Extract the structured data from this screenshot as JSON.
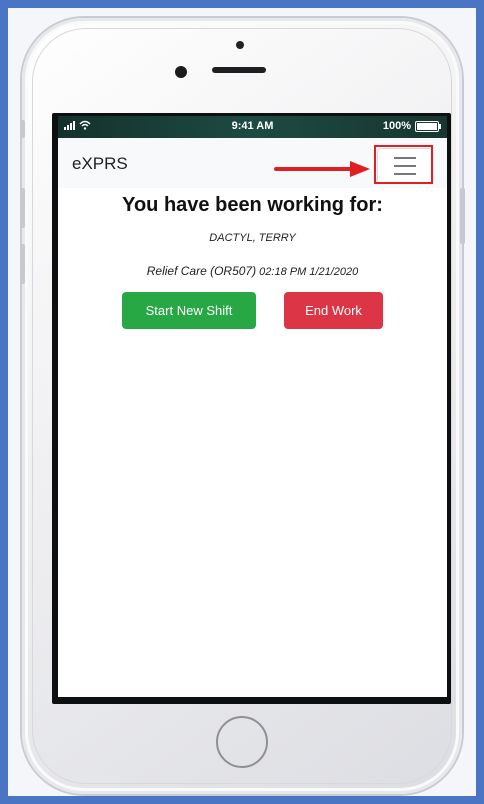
{
  "status_bar": {
    "time": "9:41 AM",
    "battery": "100%"
  },
  "app": {
    "brand": "eXPRS"
  },
  "main": {
    "heading": "You have been working for:",
    "client_name": "DACTYL, TERRY",
    "service": "Relief Care (OR507)",
    "start_time": "02:18 PM",
    "start_date": "1/21/2020",
    "start_button_label": "Start New Shift",
    "end_button_label": "End Work"
  },
  "colors": {
    "start_button": "#28a745",
    "end_button": "#dc3545",
    "annotation": "#e02020",
    "background": "#4a74c4"
  },
  "icons": {
    "menu": "hamburger-icon",
    "annotation_arrow": "arrow-right-icon",
    "signal": "signal-icon",
    "wifi": "wifi-icon",
    "battery": "battery-icon"
  }
}
